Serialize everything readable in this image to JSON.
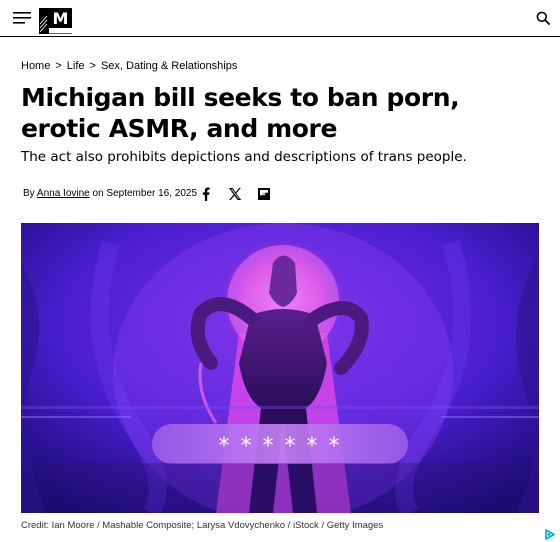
{
  "header": {
    "logo_letter": "M",
    "icons": [
      "hamburger-menu-icon",
      "mashable-logo",
      "search-icon"
    ]
  },
  "breadcrumb": {
    "items": [
      "Home",
      "Life",
      "Sex, Dating & Relationships"
    ],
    "separator": ">"
  },
  "article": {
    "headline": "Michigan bill seeks to ban porn, erotic ASMR, and more",
    "subhead": "The act also prohibits depictions and descriptions of trans people.",
    "byline_prefix": "By",
    "author": "Anna Iovine",
    "byline_on": "on",
    "date": "September 16, 2025",
    "share_icons": [
      "facebook-icon",
      "x-icon",
      "flipboard-icon"
    ]
  },
  "hero": {
    "password_mask": "* * * * * *",
    "credit": "Credit: Ian Moore / Mashable Composite; Larysa Vdovychenko / iStock / Getty Images"
  },
  "colors": {
    "accent": "#000000",
    "hero_purple": "#4a1fd0",
    "hero_magenta": "#d648e8"
  }
}
